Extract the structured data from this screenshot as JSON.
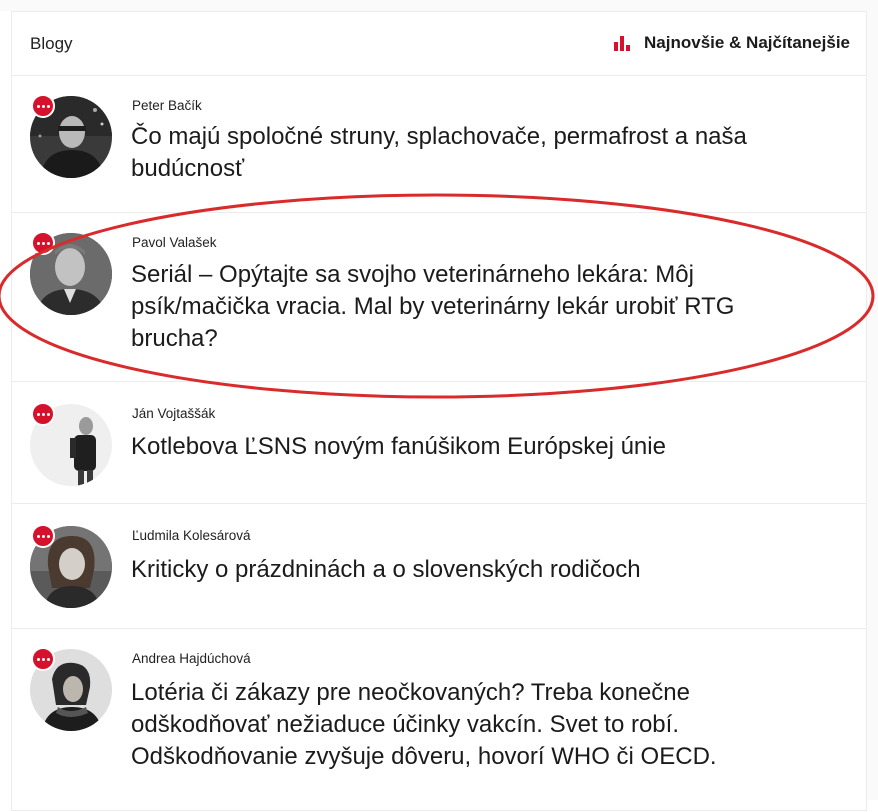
{
  "header": {
    "title": "Blogy",
    "link_label": "Najnovšie & Najčítanejšie",
    "icon": "bar-chart-icon",
    "accent_color": "#d6112b"
  },
  "posts": [
    {
      "author": "Peter Bačík",
      "title": "Čo majú spoločné struny, splachovače, permafrost a naša budúcnosť",
      "badge_icon": "more-dots-icon"
    },
    {
      "author": "Pavol Valašek",
      "title": "Seriál – Opýtajte sa svojho veterinárneho lekára: Môj psík/mačička vracia. Mal by veterinárny lekár urobiť RTG brucha?",
      "badge_icon": "more-dots-icon",
      "highlighted": true
    },
    {
      "author": "Ján Vojtaššák",
      "title": "Kotlebova ĽSNS novým fanúšikom Európskej únie",
      "badge_icon": "more-dots-icon"
    },
    {
      "author": "Ľudmila Kolesárová",
      "title": "Kriticky o prázdninách a o slovenských rodičoch",
      "badge_icon": "more-dots-icon"
    },
    {
      "author": "Andrea Hajdúchová",
      "title": "Lotéria či zákazy pre neočkovaných? Treba konečne odškodňovať nežiaduce účinky vakcín. Svet to robí. Odškodňovanie zvyšuje dôveru, hovorí WHO či OECD.",
      "badge_icon": "more-dots-icon"
    }
  ]
}
